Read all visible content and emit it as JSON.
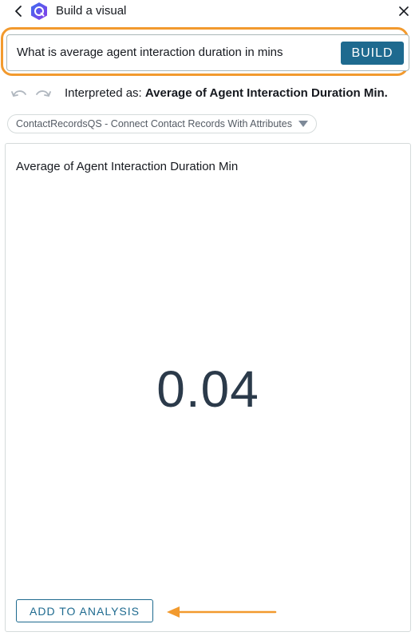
{
  "header": {
    "title": "Build a visual",
    "back_icon": "chevron-left-icon",
    "logo_icon": "quicksight-q-logo",
    "close_icon": "close-icon"
  },
  "query": {
    "value": "What is average agent interaction duration in mins",
    "build_label": "BUILD"
  },
  "interpretation": {
    "prefix": "Interpreted as:",
    "value": "Average of Agent Interaction Duration Min."
  },
  "dataset": {
    "label": "ContactRecordsQS - Connect Contact Records With Attributes"
  },
  "visual": {
    "title": "Average of Agent Interaction Duration Min",
    "kpi_value": "0.04",
    "add_label": "ADD TO ANALYSIS"
  },
  "colors": {
    "highlight": "#f29a2e",
    "primary": "#1e6a8f",
    "kpi_text": "#2b3a4a"
  }
}
